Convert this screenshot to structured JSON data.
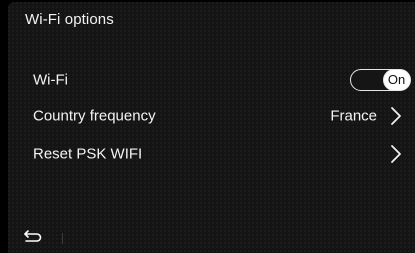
{
  "header": {
    "title": "Wi-Fi options"
  },
  "rows": {
    "wifi": {
      "label": "Wi-Fi",
      "toggle_value": "On"
    },
    "country": {
      "label": "Country frequency",
      "value": "France",
      "icon": "chevron-right-icon"
    },
    "reset": {
      "label": "Reset PSK WIFI",
      "icon": "chevron-right-icon"
    }
  },
  "footer": {
    "back_icon": "back-arrow-icon"
  }
}
